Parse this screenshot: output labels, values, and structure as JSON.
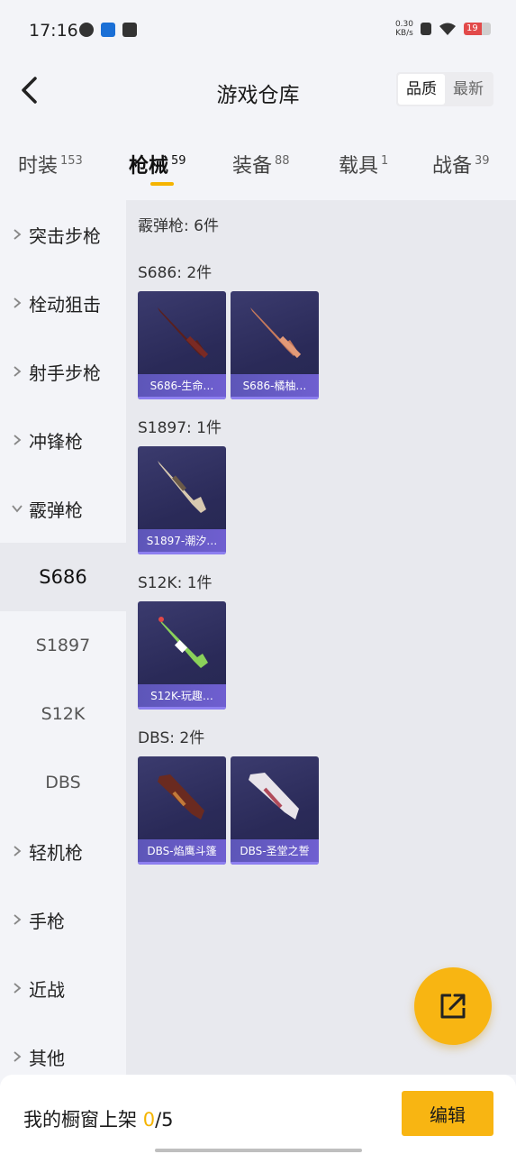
{
  "status_bar": {
    "time": "17:16",
    "net_speed_value": "0.30",
    "net_speed_unit": "KB/s",
    "battery": "19"
  },
  "header": {
    "title": "游戏仓库",
    "sort_options": [
      "品质",
      "最新"
    ],
    "sort_active": "品质"
  },
  "tabs": [
    {
      "label": "时装",
      "count": "153"
    },
    {
      "label": "枪械",
      "count": "59",
      "active": true
    },
    {
      "label": "装备",
      "count": "88"
    },
    {
      "label": "载具",
      "count": "1"
    },
    {
      "label": "战备",
      "count": "39"
    }
  ],
  "sidebar": {
    "categories": [
      "突击步枪",
      "栓动狙击",
      "射手步枪",
      "冲锋枪",
      "霰弹枪",
      "轻机枪",
      "手枪",
      "近战",
      "其他"
    ],
    "expanded": "霰弹枪",
    "subcategories": [
      "S686",
      "S1897",
      "S12K",
      "DBS"
    ],
    "active_sub": "S686"
  },
  "main": {
    "summary": "霰弹枪: 6件",
    "groups": [
      {
        "title": "S686: 2件",
        "items": [
          "S686-生命…",
          "S686-橘柚…"
        ]
      },
      {
        "title": "S1897: 1件",
        "items": [
          "S1897-潮汐…"
        ]
      },
      {
        "title": "S12K: 1件",
        "items": [
          "S12K-玩趣…"
        ]
      },
      {
        "title": "DBS: 2件",
        "items": [
          "DBS-焰鹰斗篷",
          "DBS-圣堂之誓"
        ]
      }
    ]
  },
  "bottom": {
    "showcase_prefix": "我的橱窗上架",
    "showcase_count": "0",
    "showcase_total": "/5",
    "edit_label": "编辑"
  },
  "colors": {
    "accent": "#f8b512",
    "card_label": "#6f5fd0",
    "card_bg": "#2a2a58"
  }
}
